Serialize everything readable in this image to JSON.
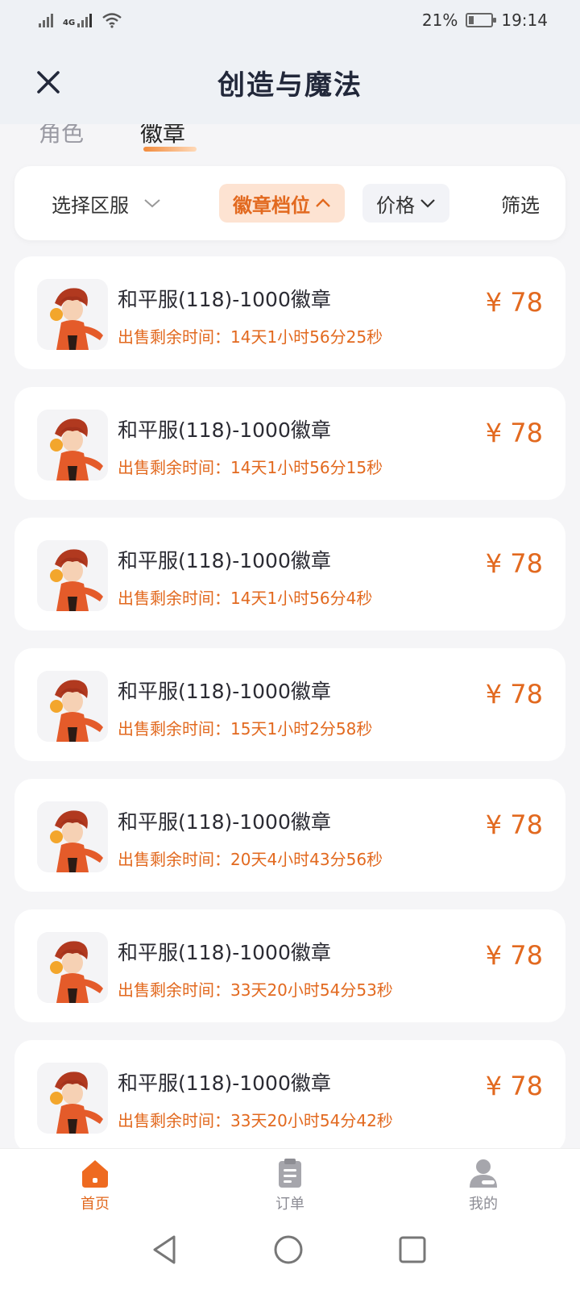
{
  "status": {
    "network_label": "4G",
    "battery_text": "21%",
    "battery_level": 0.21,
    "time": "19:14"
  },
  "header": {
    "title": "创造与魔法"
  },
  "tabs": [
    {
      "label": "角色",
      "active": false
    },
    {
      "label": "徽章",
      "active": true
    }
  ],
  "filters": {
    "region": "选择区服",
    "level": "徽章档位",
    "price": "价格",
    "filter": "筛选"
  },
  "listings": [
    {
      "title": "和平服(118)-1000徽章",
      "time": "出售剩余时间：14天1小时56分25秒",
      "price": "¥ 78"
    },
    {
      "title": "和平服(118)-1000徽章",
      "time": "出售剩余时间：14天1小时56分15秒",
      "price": "¥ 78"
    },
    {
      "title": "和平服(118)-1000徽章",
      "time": "出售剩余时间：14天1小时56分4秒",
      "price": "¥ 78"
    },
    {
      "title": "和平服(118)-1000徽章",
      "time": "出售剩余时间：15天1小时2分58秒",
      "price": "¥ 78"
    },
    {
      "title": "和平服(118)-1000徽章",
      "time": "出售剩余时间：20天4小时43分56秒",
      "price": "¥ 78"
    },
    {
      "title": "和平服(118)-1000徽章",
      "time": "出售剩余时间：33天20小时54分53秒",
      "price": "¥ 78"
    },
    {
      "title": "和平服(118)-1000徽章",
      "time": "出售剩余时间：33天20小时54分42秒",
      "price": "¥ 78"
    }
  ],
  "bottom_nav": [
    {
      "label": "首页",
      "icon": "home-icon",
      "active": true
    },
    {
      "label": "订单",
      "icon": "clipboard-icon",
      "active": false
    },
    {
      "label": "我的",
      "icon": "user-icon",
      "active": false
    }
  ],
  "colors": {
    "accent": "#e2691f",
    "accent_bg": "#fde3d2",
    "page_bg": "#f5f5f7"
  }
}
